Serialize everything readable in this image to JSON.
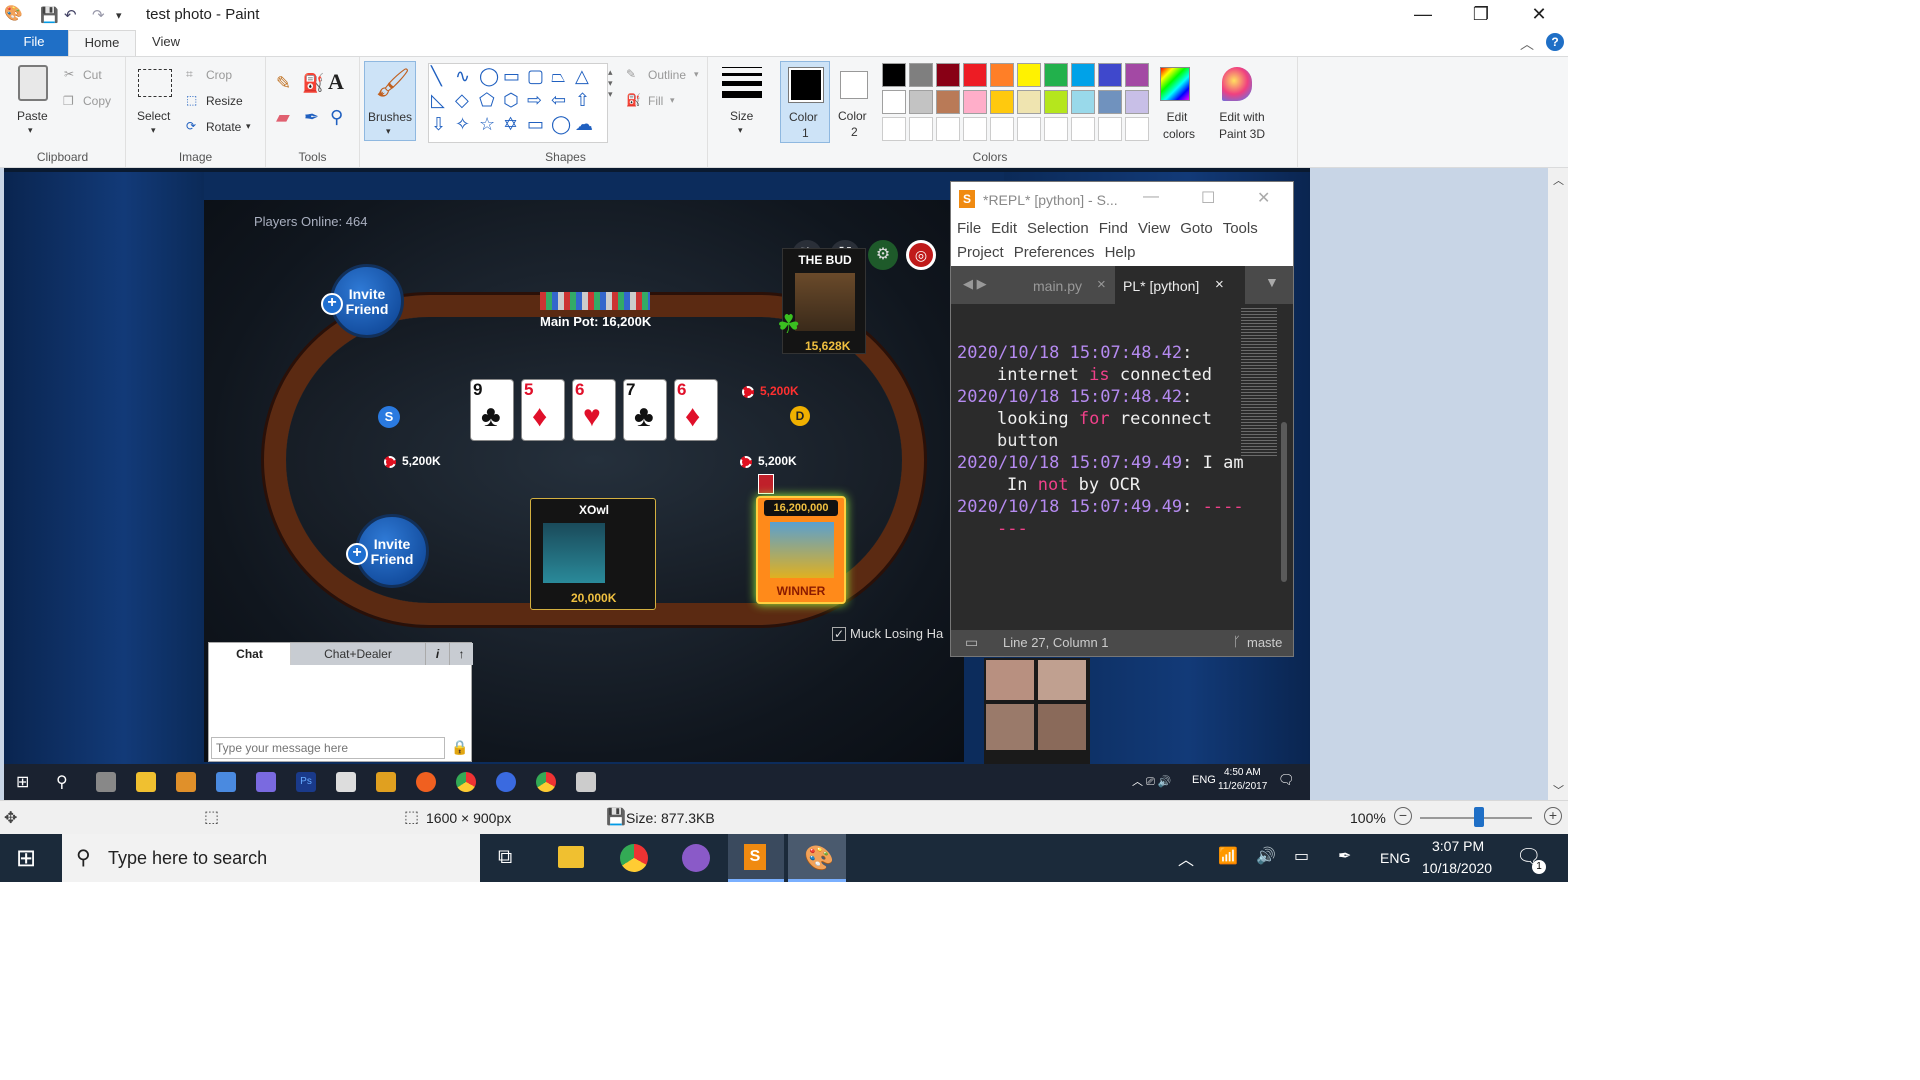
{
  "window": {
    "title": "test photo - Paint",
    "minimize_glyph": "—",
    "maximize_glyph": "❐",
    "close_glyph": "✕"
  },
  "ribbon_tabs": {
    "file": "File",
    "home": "Home",
    "view": "View"
  },
  "ribbon": {
    "clipboard": {
      "paste": "Paste",
      "cut": "Cut",
      "copy": "Copy",
      "group": "Clipboard"
    },
    "image": {
      "select": "Select",
      "crop": "Crop",
      "resize": "Resize",
      "rotate": "Rotate",
      "group": "Image"
    },
    "tools": {
      "group": "Tools"
    },
    "brushes": {
      "label": "Brushes"
    },
    "shapes": {
      "outline": "Outline",
      "fill": "Fill",
      "group": "Shapes"
    },
    "size": {
      "label": "Size"
    },
    "color1": {
      "label": "Color",
      "num": "1"
    },
    "color2": {
      "label": "Color",
      "num": "2"
    },
    "colors": {
      "group": "Colors",
      "edit_colors": "Edit colors",
      "edit_with": "Edit with Paint 3D"
    },
    "palette_row1": [
      "#000000",
      "#7f7f7f",
      "#880015",
      "#ed1c24",
      "#ff7f27",
      "#fff200",
      "#22b14c",
      "#00a2e8",
      "#3f48cc",
      "#a349a4"
    ],
    "palette_row2": [
      "#ffffff",
      "#c3c3c3",
      "#b97a57",
      "#ffaec9",
      "#ffc90e",
      "#efe4b0",
      "#b5e61d",
      "#99d9ea",
      "#7092be",
      "#c8bfe7"
    ]
  },
  "game": {
    "players_online": "Players Online: 464",
    "main_pot": "Main Pot: 16,200K",
    "invite_top": {
      "line1": "Invite",
      "line2": "Friend"
    },
    "invite_bottom": {
      "line1": "Invite",
      "line2": "Friend"
    },
    "board_cards": [
      {
        "rank": "9",
        "suit": "♣",
        "color": "blk"
      },
      {
        "rank": "5",
        "suit": "♦",
        "color": "red"
      },
      {
        "rank": "6",
        "suit": "♥",
        "color": "red"
      },
      {
        "rank": "7",
        "suit": "♣",
        "color": "blk"
      },
      {
        "rank": "6",
        "suit": "♦",
        "color": "red"
      }
    ],
    "player_bud": {
      "name": "THE BUD",
      "chips": "15,628K"
    },
    "bet_right_top": "5,200K",
    "bet_left": "5,200K",
    "bet_right": "5,200K",
    "dealer_badge": "D",
    "s_badge": "S",
    "player_xowl": {
      "name": "XOwl",
      "chips": "20,000K"
    },
    "winner": {
      "amount": "16,200,000",
      "label": "WINNER"
    },
    "muck": "Muck Losing Ha",
    "chat": {
      "tab_chat": "Chat",
      "tab_dealer": "Chat+Dealer",
      "info": "i",
      "up": "↑",
      "placeholder": "Type your message here"
    }
  },
  "sublime": {
    "title": "*REPL* [python] - S...",
    "menu_row1": [
      "File",
      "Edit",
      "Selection",
      "Find",
      "View",
      "Goto",
      "Tools"
    ],
    "menu_row2": [
      "Project",
      "Preferences",
      "Help"
    ],
    "tab1": "main.py",
    "tab2": "PL* [python]",
    "close": "×",
    "log": [
      {
        "ts": "2020/10/18 15:07:48.42",
        "parts": [
          {
            "t": "internet ",
            "c": "w"
          },
          {
            "t": "is",
            "c": "k"
          },
          {
            "t": " connected",
            "c": "w"
          }
        ]
      },
      {
        "ts": "2020/10/18 15:07:48.42",
        "parts": [
          {
            "t": "looking ",
            "c": "w"
          },
          {
            "t": "for",
            "c": "k"
          },
          {
            "t": " reconnect",
            "c": "w"
          }
        ],
        "cont": "button"
      },
      {
        "ts": "2020/10/18 15:07:49.49",
        "parts": [
          {
            "t": " I am",
            "c": "w"
          }
        ],
        "cont_parts": [
          {
            "t": "In ",
            "c": "w"
          },
          {
            "t": "not",
            "c": "k"
          },
          {
            "t": " by OCR",
            "c": "w"
          }
        ]
      },
      {
        "ts": "2020/10/18 15:07:49.49",
        "parts": [
          {
            "t": " ----",
            "c": "k"
          }
        ],
        "cont_dash": "---"
      }
    ],
    "status_pos": "Line 27, Column 1",
    "status_branch": "maste"
  },
  "inner_taskbar": {
    "lang": "ENG",
    "time": "4:50 AM",
    "date": "11/26/2017",
    "zoom": "100%"
  },
  "statusbar": {
    "dimensions": "1600 × 900px",
    "size": "Size: 877.3KB",
    "zoom": "100%"
  },
  "taskbar": {
    "search": "Type here to search",
    "lang": "ENG",
    "time": "3:07 PM",
    "date": "10/18/2020",
    "notif_count": "1"
  }
}
